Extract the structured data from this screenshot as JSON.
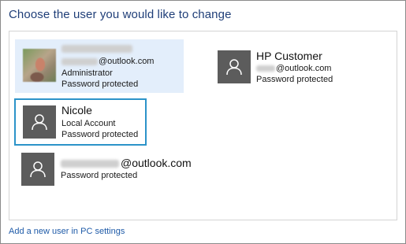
{
  "page_title": "Choose the user you would like to change",
  "accounts": [
    {
      "name": "",
      "email_domain": "@outlook.com",
      "type": "Administrator",
      "status": "Password protected",
      "avatar": "photo",
      "selected": true
    },
    {
      "name": "HP Customer",
      "email_domain": "@outlook.com",
      "status": "Password protected",
      "avatar": "person-icon"
    },
    {
      "name": "Nicole",
      "type": "Local Account",
      "status": "Password protected",
      "avatar": "person-icon",
      "focused": true
    },
    {
      "email_domain": "@outlook.com",
      "status": "Password protected",
      "avatar": "person-icon"
    }
  ],
  "add_user_link": "Add a new user in PC settings",
  "colors": {
    "title": "#1f3e78",
    "selected_bg": "#e3eefb",
    "focus_border": "#2c93c9",
    "avatar_bg": "#5c5c5c",
    "link": "#1f5ba8"
  }
}
